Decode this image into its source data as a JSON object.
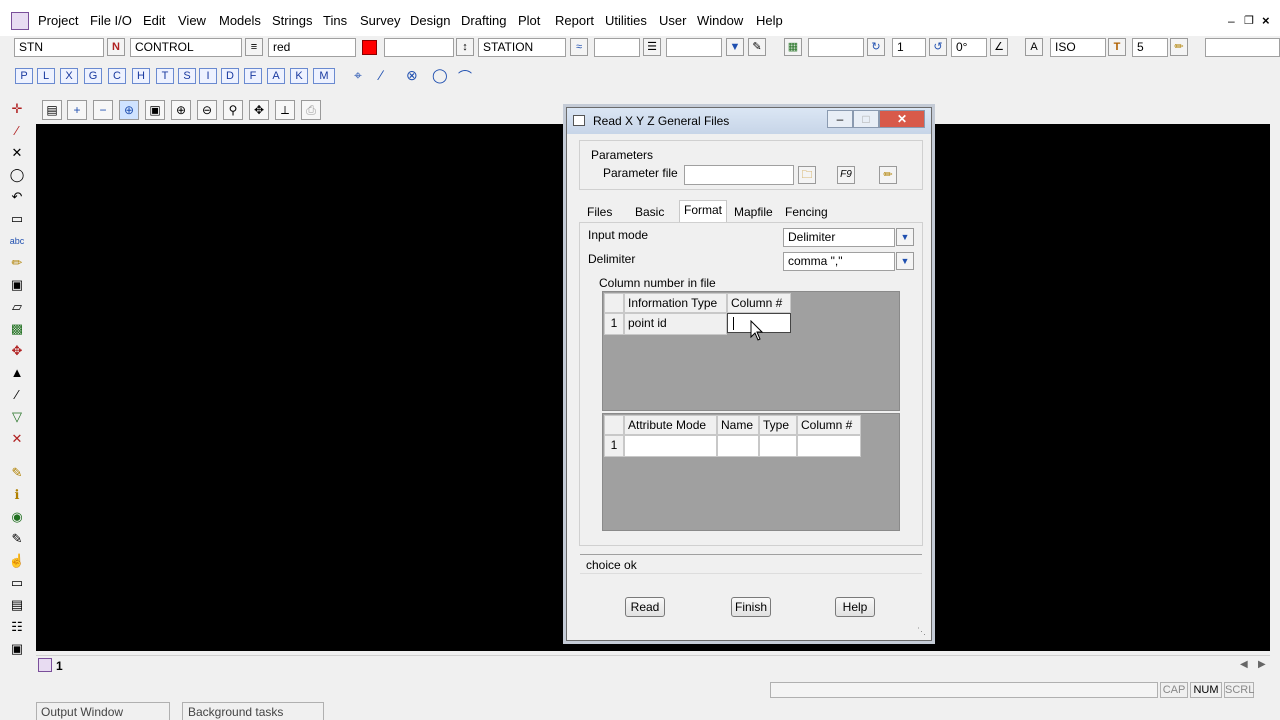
{
  "menu": [
    "Project",
    "File I/O",
    "Edit",
    "View",
    "Models",
    "Strings",
    "Tins",
    "Survey",
    "Design",
    "Drafting",
    "Plot",
    "Report",
    "Utilities",
    "User",
    "Window",
    "Help"
  ],
  "toolbar": {
    "name_field": "STN",
    "n_button": "N",
    "model_field": "CONTROL",
    "colour_field": "red",
    "colour_swatch": "#ff0000",
    "style_field": "STATION",
    "weight_value": "1",
    "angle_value": "0°",
    "text_style": "ISO",
    "text_btn": "T",
    "text_size": "5"
  },
  "letter_buttons": [
    "P",
    "L",
    "X",
    "G",
    "C",
    "H",
    "T",
    "S",
    "I",
    "D",
    "F",
    "A",
    "K",
    "M"
  ],
  "view_tab": "1",
  "dialog": {
    "title": "Read X Y Z General Files",
    "params_label": "Parameters",
    "param_file_label": "Parameter file",
    "param_file_value": "",
    "tabs": [
      "Files",
      "Basic",
      "Format",
      "Mapfile",
      "Fencing"
    ],
    "input_mode_label": "Input mode",
    "input_mode_value": "Delimiter",
    "delimiter_label": "Delimiter",
    "delimiter_value": "comma \",\"",
    "column_group_label": "Column number in file",
    "info_grid": {
      "headers": [
        "Information Type",
        "Column #"
      ],
      "rows": [
        {
          "num": "1",
          "type": "point id",
          "column": ""
        }
      ]
    },
    "attr_grid": {
      "headers": [
        "Attribute Mode",
        "Name",
        "Type",
        "Column #"
      ],
      "rows": [
        {
          "num": "1",
          "mode": "",
          "name": "",
          "type": "",
          "column": ""
        }
      ]
    },
    "message": "choice ok",
    "buttons": {
      "read": "Read",
      "finish": "Finish",
      "help": "Help"
    }
  },
  "status": {
    "cap": "CAP",
    "num": "NUM",
    "scrl": "SCRL",
    "output_tab": "Output Window",
    "background_tab": "Background tasks"
  }
}
